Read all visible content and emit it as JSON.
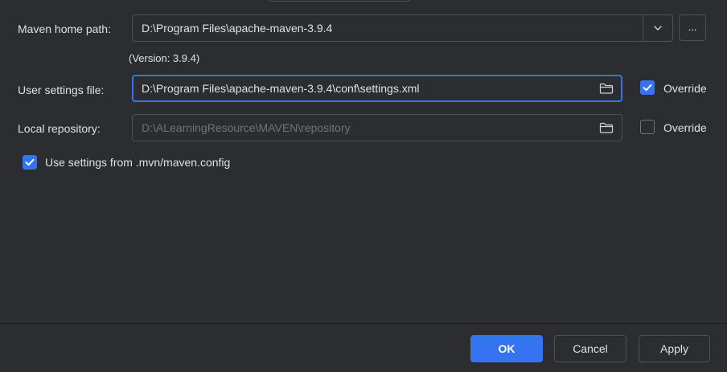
{
  "maven_home": {
    "label": "Maven home path:",
    "value": "D:\\Program Files\\apache-maven-3.9.4",
    "browse_label": "...",
    "version_text": "(Version: 3.9.4)"
  },
  "user_settings": {
    "label": "User settings file:",
    "value": "D:\\Program Files\\apache-maven-3.9.4\\conf\\settings.xml",
    "override_label": "Override",
    "override_checked": true
  },
  "local_repository": {
    "label": "Local repository:",
    "value": "D:\\ALearningResource\\MAVEN\\repository",
    "override_label": "Override",
    "override_checked": false
  },
  "mvn_config": {
    "label": "Use settings from .mvn/maven.config",
    "checked": true
  },
  "footer": {
    "ok_label": "OK",
    "cancel_label": "Cancel",
    "apply_label": "Apply"
  },
  "colors": {
    "background": "#2b2d30",
    "accent": "#3574f0",
    "text": "#dfe1e5",
    "disabled_text": "#6f737a"
  }
}
